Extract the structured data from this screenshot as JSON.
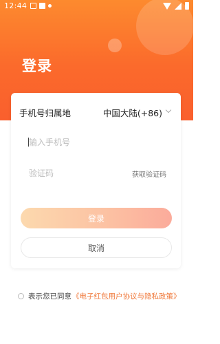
{
  "status_bar": {
    "time": "12:44"
  },
  "header": {
    "title": "登录"
  },
  "form": {
    "region_label": "手机号归属地",
    "region_value": "中国大陆(+86)",
    "phone_placeholder": "输入手机号",
    "code_placeholder": "验证码",
    "get_code_label": "获取验证码"
  },
  "buttons": {
    "login_label": "登录",
    "cancel_label": "取消"
  },
  "agreement": {
    "text": "表示您已同意",
    "link": "《电子红包用户协议与隐私政策》"
  },
  "colors": {
    "accent": "#fa6a2c",
    "link": "#f07a3c",
    "login_button_start": "#fcd9ae",
    "login_button_end": "#fbab9b"
  }
}
